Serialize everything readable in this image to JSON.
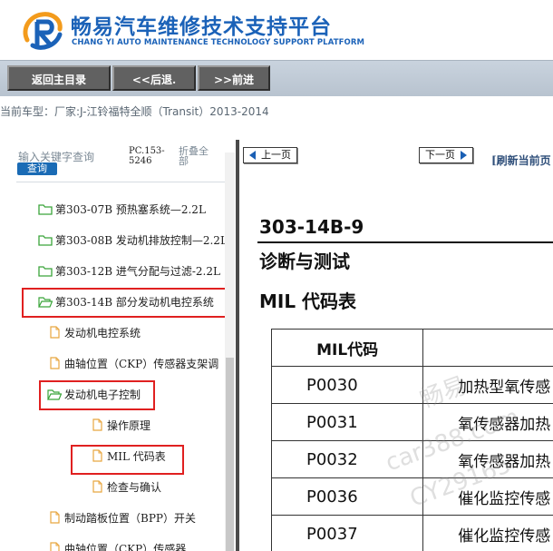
{
  "brand": {
    "title": "畅易汽车维修技术支持平台",
    "subtitle": "CHANG YI AUTO MAINTENANCE TECHNOLOGY SUPPORT PLATFORM",
    "accent_color": "#1b62b8"
  },
  "nav": {
    "home_label": "返回主目录",
    "back_label": "<<后退.",
    "forward_label": ">>前进"
  },
  "vehicle": {
    "label": "当前车型：",
    "value": "厂家:J-江铃福特全顺（Transit）2013-2014"
  },
  "sidebar": {
    "search_placeholder": "输入关键字查询",
    "search_button": "查询",
    "pc_code": "PC.153-5246",
    "collapse_all": "折叠全部",
    "items": [
      {
        "label": "第303-07B 预热塞系统—2.2L",
        "icon": "folder-icon"
      },
      {
        "label": "第303-08B 发动机排放控制—2.2L",
        "icon": "folder-icon"
      },
      {
        "label": "第303-12B 进气分配与过滤-2.2L",
        "icon": "folder-icon"
      },
      {
        "label": "第303-14B 部分发动机电控系统",
        "icon": "folder-open-icon"
      },
      {
        "label": "发动机电控系统",
        "icon": "document-icon"
      },
      {
        "label": "曲轴位置（CKP）传感器支架调",
        "icon": "document-icon"
      },
      {
        "label": "发动机电子控制",
        "icon": "folder-open-icon"
      },
      {
        "label": "操作原理",
        "icon": "document-icon"
      },
      {
        "label": "MIL 代码表",
        "icon": "document-icon"
      },
      {
        "label": "检查与确认",
        "icon": "document-icon"
      },
      {
        "label": "制动踏板位置（BPP）开关",
        "icon": "document-icon"
      },
      {
        "label": "曲轴位置（CKP）传感器",
        "icon": "document-icon"
      }
    ]
  },
  "pager": {
    "prev_label": "上一页",
    "next_label": "下一页",
    "refresh_label": "[刷新当前页"
  },
  "doc": {
    "code": "303-14B-9",
    "section": "诊断与测试",
    "table_title": "MIL 代码表",
    "table": {
      "headers": [
        "MIL代码",
        ""
      ],
      "rows": [
        {
          "code": "P0030",
          "desc": "加热型氧传感"
        },
        {
          "code": "P0031",
          "desc": "氧传感器加热"
        },
        {
          "code": "P0032",
          "desc": "氧传感器加热"
        },
        {
          "code": "P0036",
          "desc": "催化监控传感"
        },
        {
          "code": "P0037",
          "desc": "催化监控传感"
        }
      ]
    }
  },
  "watermark": {
    "line1": "畅易",
    "line2": "car388.com",
    "line3": "CY29165"
  }
}
